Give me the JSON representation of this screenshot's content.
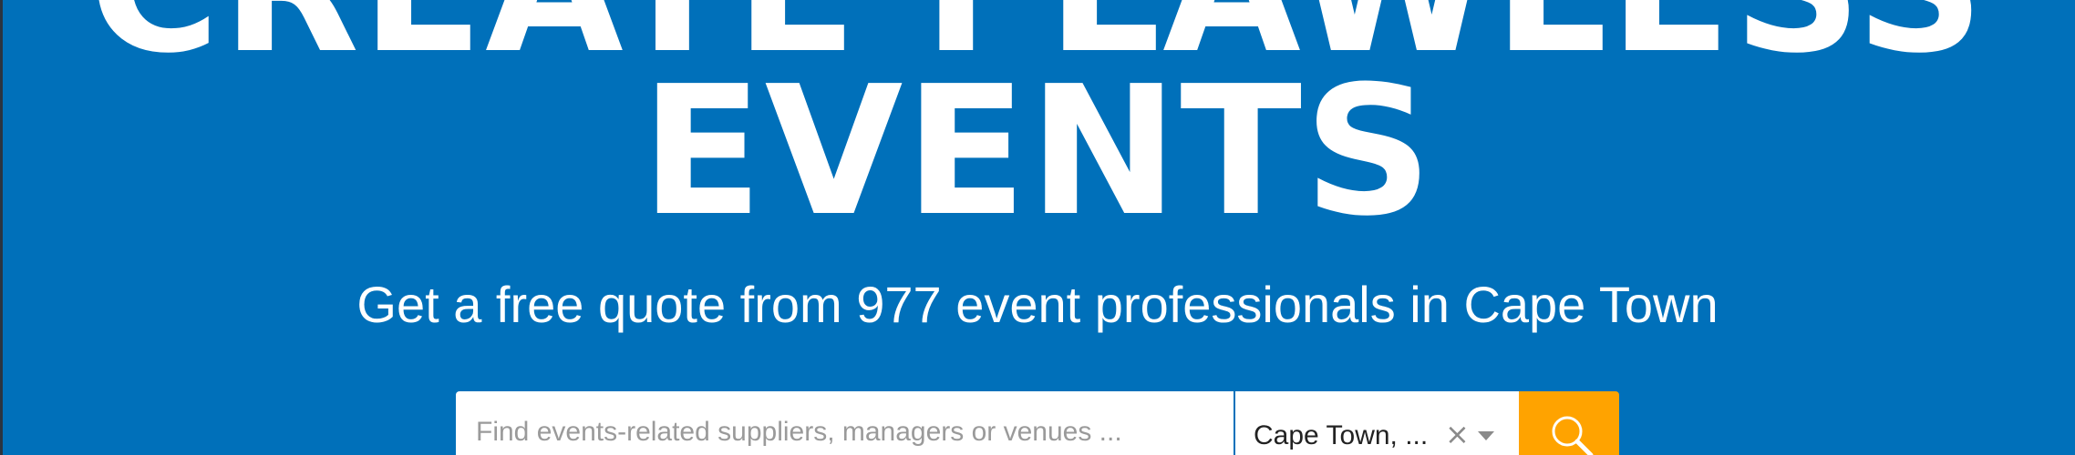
{
  "hero": {
    "headline_line1": "CREATE FLAWLESS",
    "headline_line2": "EVENTS",
    "subtitle": "Get a free quote from 977 event professionals in Cape Town"
  },
  "search": {
    "placeholder": "Find events-related suppliers, managers or venues ...",
    "value": "",
    "location_value": "Cape Town, ...",
    "clear_icon": "×",
    "button_icon": "search-icon"
  },
  "colors": {
    "background": "#0070BA",
    "search_button": "#FFA300",
    "text": "#FFFFFF"
  }
}
